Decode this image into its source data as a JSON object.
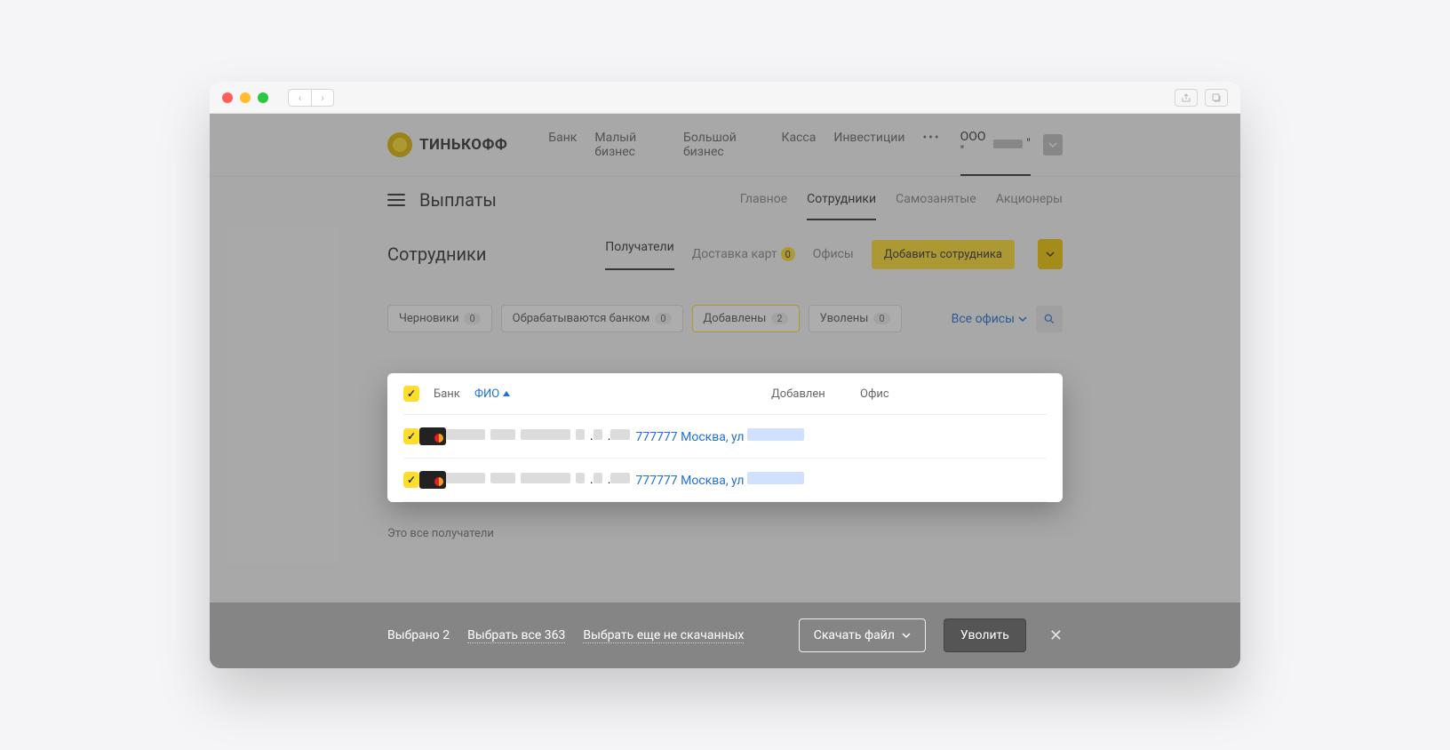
{
  "brand": "ТИНЬКОФФ",
  "topnav": {
    "items": [
      "Банк",
      "Малый бизнес",
      "Большой бизнес",
      "Касса",
      "Инвестиции"
    ],
    "more": "•••",
    "account_prefix": "ООО \"",
    "account_suffix": "\""
  },
  "section": {
    "title": "Выплаты",
    "tabs": [
      "Главное",
      "Сотрудники",
      "Самозанятые",
      "Акционеры"
    ],
    "active": "Сотрудники"
  },
  "sub": {
    "title": "Сотрудники",
    "tabs": [
      {
        "label": "Получатели",
        "active": true
      },
      {
        "label": "Доставка карт",
        "badge": "0"
      },
      {
        "label": "Офисы"
      }
    ],
    "addBtn": "Добавить сотрудника"
  },
  "filters": {
    "chips": [
      {
        "label": "Черновики",
        "count": "0"
      },
      {
        "label": "Обрабатываются банком",
        "count": "0"
      },
      {
        "label": "Добавлены",
        "count": "2",
        "selected": true
      },
      {
        "label": "Уволены",
        "count": "0"
      }
    ],
    "offices": "Все офисы"
  },
  "table": {
    "headers": {
      "bank": "Банк",
      "name": "ФИО",
      "date": "Добавлен",
      "office": "Офис"
    },
    "rows": [
      {
        "date": " .  . ",
        "office_code": "777777",
        "office_text": "Москва, ул"
      },
      {
        "date": " .  . ",
        "office_code": "777777",
        "office_text": "Москва, ул"
      }
    ],
    "end": "Это все получатели"
  },
  "footer": {
    "selected": "Выбрано 2",
    "selectAll": "Выбрать все 363",
    "selectNot": "Выбрать еще не скачанных",
    "download": "Скачать файл",
    "fire": "Уволить"
  }
}
